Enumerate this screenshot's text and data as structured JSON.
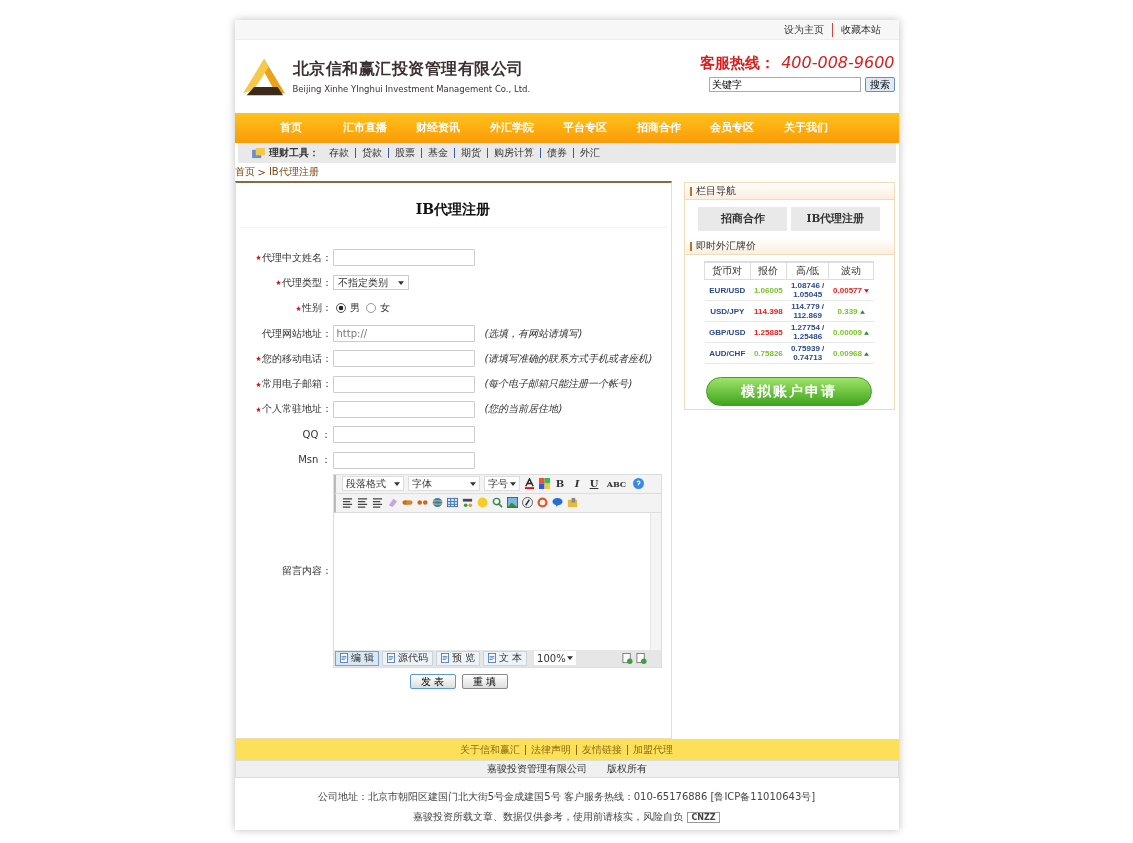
{
  "top_links": [
    "设为主页",
    "收藏本站"
  ],
  "header": {
    "company_name": "北京信和赢汇投资管理有限公司",
    "company_name_en": "Beijing Xinhe YInghui Investment Management Co., Ltd.",
    "hotline_label": "客服热线：",
    "hotline_number": "400-008-9600",
    "search": {
      "value": "关键字",
      "button": "搜索"
    }
  },
  "nav": [
    "首页",
    "汇市直播",
    "财经资讯",
    "外汇学院",
    "平台专区",
    "招商合作",
    "会员专区",
    "关于我们"
  ],
  "tools": {
    "label": "理财工具：",
    "items": [
      "存款",
      "贷款",
      "股票",
      "基金",
      "期货",
      "购房计算",
      "债券",
      "外汇"
    ]
  },
  "breadcrumb": {
    "items": [
      "首页",
      "IB代理注册"
    ],
    "separator": ">"
  },
  "form": {
    "title": "IB代理注册",
    "fields": [
      {
        "kind": "text",
        "label": "代理中文姓名：",
        "required": true
      },
      {
        "kind": "select",
        "label": "代理类型：",
        "required": true,
        "value": "不指定类别"
      },
      {
        "kind": "radio",
        "label": "性别：",
        "required": true,
        "options": [
          {
            "label": "男",
            "selected": true
          },
          {
            "label": "女",
            "selected": false
          }
        ]
      },
      {
        "kind": "text",
        "label": "代理网站地址：",
        "required": false,
        "placeholder": "http://",
        "hint": "(选填，有网站请填写)"
      },
      {
        "kind": "text",
        "label": "您的移动电话：",
        "required": true,
        "hint": "(请填写准确的联系方式手机或者座机)"
      },
      {
        "kind": "text",
        "label": "常用电子邮箱：",
        "required": true,
        "hint": "(每个电子邮箱只能注册一个帐号)"
      },
      {
        "kind": "text",
        "label": "个人常驻地址：",
        "required": true,
        "hint": "(您的当前居住地)"
      },
      {
        "kind": "text",
        "label": "QQ ：",
        "required": false
      },
      {
        "kind": "text",
        "label": "Msn ：",
        "required": false
      }
    ],
    "editor": {
      "label": "留言内容：",
      "selects": [
        "段落格式",
        "字体",
        "字号"
      ],
      "format_buttons": [
        "B",
        "I",
        "U",
        "ABC"
      ],
      "modes": [
        {
          "label": "编 辑",
          "selected": true
        },
        {
          "label": "源代码",
          "selected": false
        },
        {
          "label": "预 览",
          "selected": false
        },
        {
          "label": "文 本",
          "selected": false
        }
      ],
      "zoom": "100%"
    },
    "buttons": [
      "发 表",
      "重 填"
    ]
  },
  "sidebar": {
    "nav_title": "栏目导航",
    "nav_links": [
      "招商合作",
      "IB代理注册"
    ],
    "rates_title": "即时外汇牌价",
    "columns": [
      "货币对",
      "报价",
      "高/低",
      "波动"
    ],
    "rows": [
      {
        "pair": "EUR/USD",
        "price": "1.06005",
        "price_up": true,
        "high": "1.08746 /",
        "low": "1.05045",
        "change": "0.00577",
        "change_up": false
      },
      {
        "pair": "USD/JPY",
        "price": "114.398",
        "price_up": false,
        "high": "114.779 /",
        "low": "112.869",
        "change": "0.339",
        "change_up": true
      },
      {
        "pair": "GBP/USD",
        "price": "1.25885",
        "price_up": false,
        "high": "1.27754 /",
        "low": "1.25486",
        "change": "0.00009",
        "change_up": true
      },
      {
        "pair": "AUD/CHF",
        "price": "0.75826",
        "price_up": true,
        "high": "0.75939 /",
        "low": "0.74713",
        "change": "0.00968",
        "change_up": true
      }
    ],
    "apply_button": "模拟账户申请"
  },
  "footer": {
    "links": [
      "关于信和赢汇",
      "法律声明",
      "友情链接",
      "加盟代理"
    ],
    "copyright": [
      "嘉骏投资管理有限公司",
      "版权所有"
    ],
    "address": "公司地址：北京市朝阳区建国门北大街5号金成建国5号  客户服务热线：010-65176886 [鲁ICP备11010643号]",
    "disclaimer": "嘉骏投资所载文章、数据仅供参考，使用前请核实，风险自负",
    "badge": "CNZZ"
  }
}
